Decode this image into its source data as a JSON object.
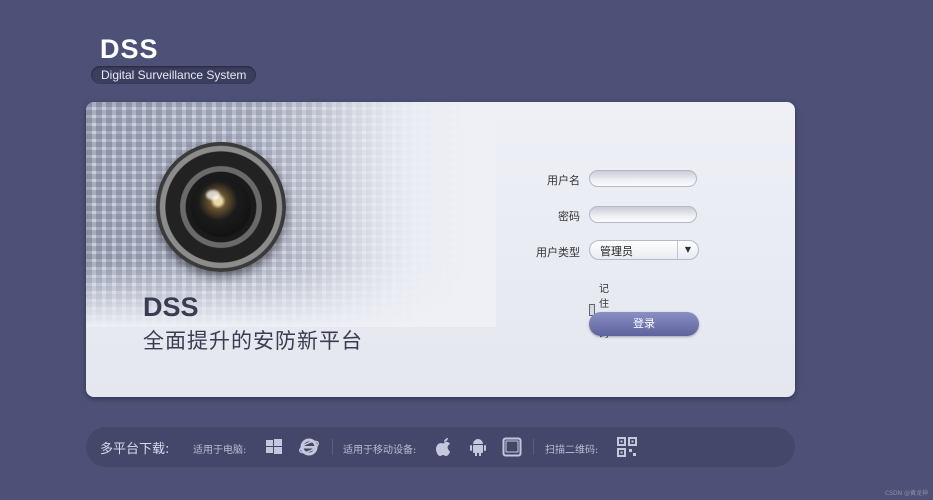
{
  "brand": {
    "logo": "DSS",
    "tagline": "Digital Surveillance System"
  },
  "hero": {
    "title": "DSS",
    "subtitle": "全面提升的安防新平台"
  },
  "login": {
    "username_label": "用户名",
    "username_value": "",
    "password_label": "密码",
    "password_value": "",
    "user_type_label": "用户类型",
    "user_type_value": "管理员",
    "remember_label": "记住密码",
    "remember_checked": false,
    "submit_label": "登录"
  },
  "download": {
    "title": "多平台下载:",
    "pc_label": "适用于电脑:",
    "pc_icons": [
      "windows-icon",
      "ie-icon"
    ],
    "mobile_label": "适用于移动设备:",
    "mobile_icons": [
      "apple-icon",
      "android-icon",
      "tablet-icon"
    ],
    "qr_label": "扫描二维码:",
    "qr_icon": "qr-code-icon"
  },
  "watermark": "CSDN @黄龙神",
  "colors": {
    "background": "#4d5177",
    "panel": "#eef0f6",
    "accent": "#6a6fac",
    "bar": "#44476a"
  }
}
